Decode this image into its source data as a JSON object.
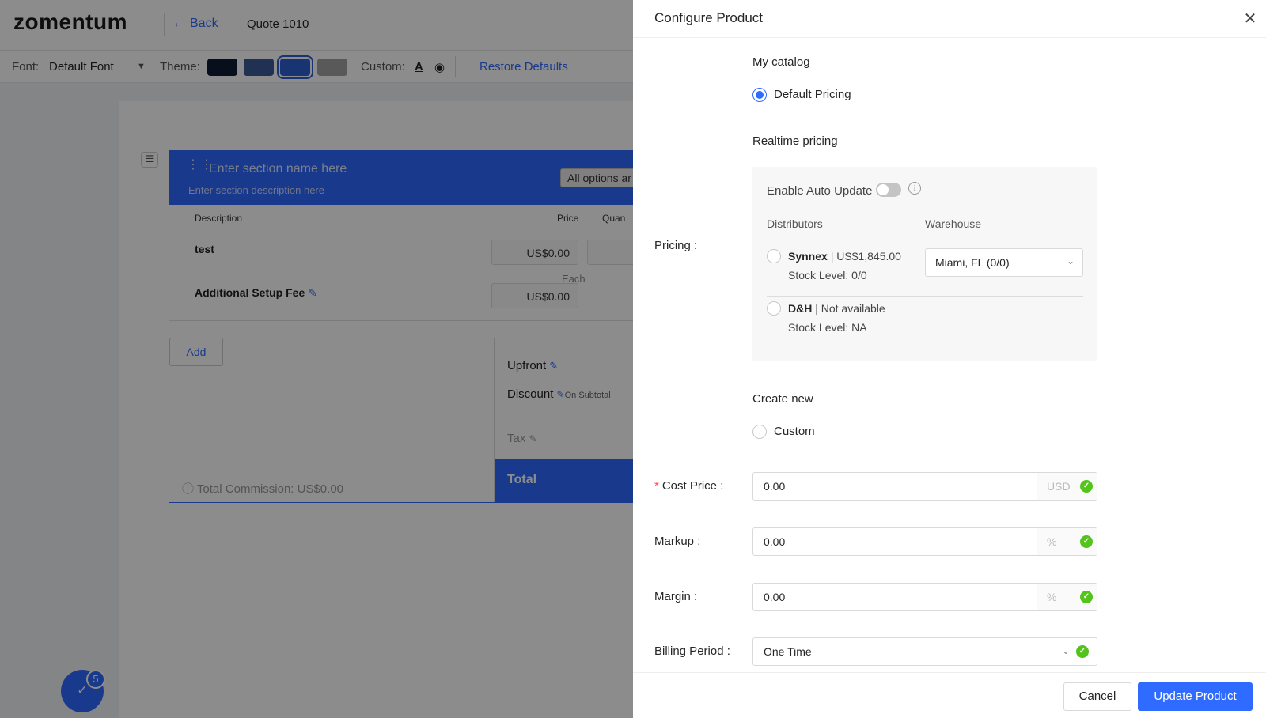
{
  "app": {
    "logo": "zomentum",
    "back_label": "Back",
    "quote_title": "Quote 1010"
  },
  "toolbar": {
    "font_label": "Font:",
    "font_value": "Default Font",
    "theme_label": "Theme:",
    "theme_colors": [
      "#0f1c33",
      "#3d5a9a",
      "#2f5fd0",
      "#a3a3a3"
    ],
    "custom_label": "Custom:",
    "restore_label": "Restore Defaults"
  },
  "section": {
    "name_placeholder": "Enter section name here",
    "desc_placeholder": "Enter section description here",
    "all_options": "All options ar",
    "columns": {
      "description": "Description",
      "price": "Price",
      "quantity": "Quan"
    },
    "rows": [
      {
        "name": "test",
        "price": "US$0.00",
        "unit": "Each"
      },
      {
        "name": "Additional Setup Fee",
        "price": "US$0.00"
      }
    ],
    "add_label": "Add",
    "summary": {
      "upfront": "Upfront",
      "discount": "Discount",
      "discount_note": "On Subtotal",
      "tax": "Tax",
      "total": "Total"
    },
    "commission": "Total Commission:  US$0.00"
  },
  "fab": {
    "badge": "5"
  },
  "drawer": {
    "title": "Configure Product",
    "my_catalog": "My catalog",
    "default_pricing": "Default Pricing",
    "realtime_pricing": "Realtime pricing",
    "pricing_label": "Pricing",
    "enable_auto_update": "Enable Auto Update",
    "distributors_header": "Distributors",
    "warehouse_header": "Warehouse",
    "distributors": [
      {
        "name": "Synnex",
        "price": "| US$1,845.00",
        "stock": "Stock Level: 0/0"
      },
      {
        "name": "D&H",
        "price": "| Not available",
        "stock": "Stock Level: NA"
      }
    ],
    "warehouse_value": "Miami, FL (0/0)",
    "create_new": "Create new",
    "custom": "Custom",
    "cost_price": {
      "label": "Cost Price",
      "value": "0.00",
      "unit": "USD"
    },
    "markup": {
      "label": "Markup",
      "value": "0.00",
      "unit": "%"
    },
    "margin": {
      "label": "Margin",
      "value": "0.00",
      "unit": "%"
    },
    "billing_period": {
      "label": "Billing Period",
      "value": "One Time"
    },
    "cancel_label": "Cancel",
    "update_label": "Update Product"
  }
}
